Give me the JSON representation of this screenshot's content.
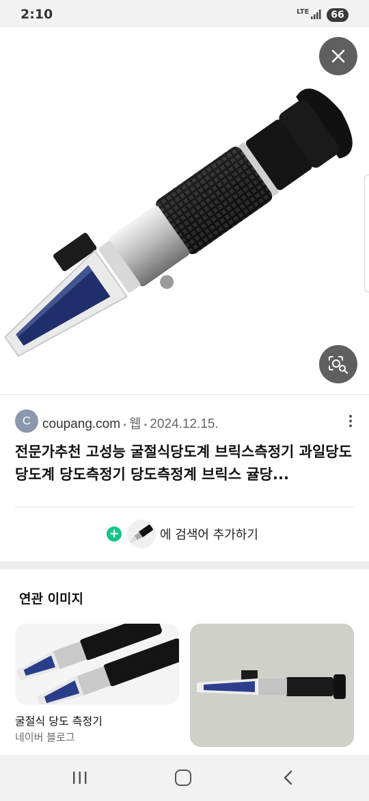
{
  "status_bar": {
    "time": "2:10",
    "network": "LTE",
    "battery": "66"
  },
  "hero": {
    "close_icon": "close-icon",
    "lens_icon": "lens-search-icon"
  },
  "result": {
    "favicon_letter": "C",
    "domain": "coupang.com",
    "type": "웹",
    "date": "2024.12.15.",
    "title": "전문가추천 고성능 굴절식당도계 브릭스측정기 과일당도 당도계 당도측정기 당도측정계 브릭스 귤당...",
    "add_to_search_label": "에 검색어 추가하기"
  },
  "related": {
    "heading": "연관 이미지",
    "items": [
      {
        "title": "굴절식 당도 측정기",
        "source": "네이버 블로그"
      },
      {
        "title": "",
        "source": ""
      }
    ]
  },
  "colors": {
    "accent_green": "#12c58b",
    "favicon_bg": "#8a97ad",
    "overlay_button": "#5f5f5f"
  }
}
